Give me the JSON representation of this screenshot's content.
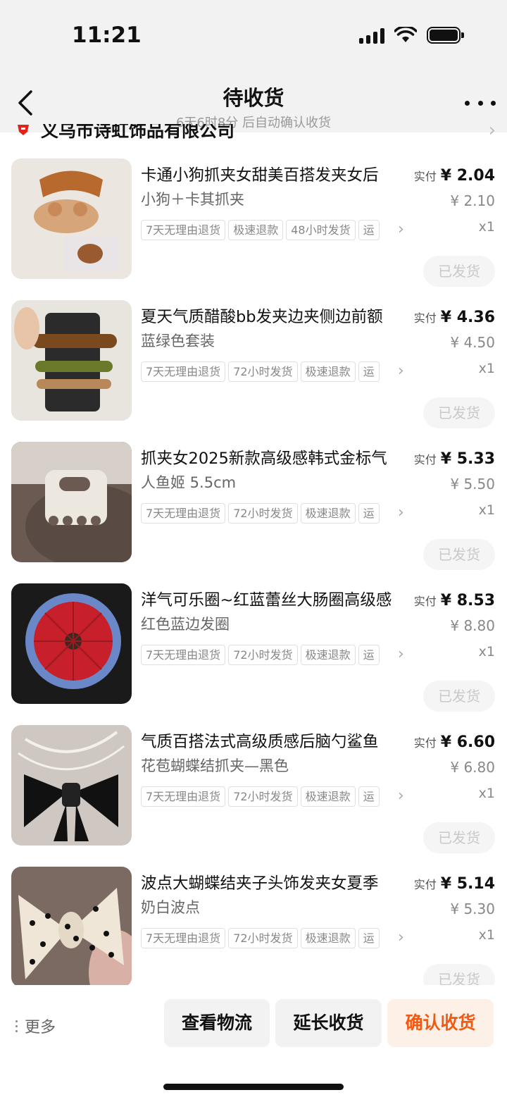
{
  "status": {
    "time": "11:21"
  },
  "nav": {
    "title": "待收货",
    "subtitle": "6天6时8分 后自动确认收货"
  },
  "shop": {
    "name": "义乌市诗虹饰品有限公司",
    "logo_icon": "shop-logo-icon"
  },
  "items": [
    {
      "title": "卡通小狗抓夹女甜美百搭发夹女后",
      "variant": "小狗＋卡其抓夹",
      "tags": [
        "7天无理由退货",
        "极速退款",
        "48小时发货",
        "运"
      ],
      "price_prefix": "实付",
      "price": "¥ 2.04",
      "original_price": "¥ 2.10",
      "qty": "x1",
      "status_button": "已发货"
    },
    {
      "title": "夏天气质醋酸bb发夹边夹侧边前额",
      "variant": "蓝绿色套装",
      "tags": [
        "7天无理由退货",
        "72小时发货",
        "极速退款",
        "运"
      ],
      "price_prefix": "实付",
      "price": "¥ 4.36",
      "original_price": "¥ 4.50",
      "qty": "x1",
      "status_button": "已发货"
    },
    {
      "title": "抓夹女2025新款高级感韩式金标气",
      "variant": "人鱼姬 5.5cm",
      "tags": [
        "7天无理由退货",
        "72小时发货",
        "极速退款",
        "运"
      ],
      "price_prefix": "实付",
      "price": "¥ 5.33",
      "original_price": "¥ 5.50",
      "qty": "x1",
      "status_button": "已发货"
    },
    {
      "title": "洋气可乐圈~红蓝蕾丝大肠圈高级感",
      "variant": "红色蓝边发圈",
      "tags": [
        "7天无理由退货",
        "72小时发货",
        "极速退款",
        "运"
      ],
      "price_prefix": "实付",
      "price": "¥ 8.53",
      "original_price": "¥ 8.80",
      "qty": "x1",
      "status_button": "已发货"
    },
    {
      "title": "气质百搭法式高级质感后脑勺鲨鱼",
      "variant": "花苞蝴蝶结抓夹—黑色",
      "tags": [
        "7天无理由退货",
        "72小时发货",
        "极速退款",
        "运"
      ],
      "price_prefix": "实付",
      "price": "¥ 6.60",
      "original_price": "¥ 6.80",
      "qty": "x1",
      "status_button": "已发货"
    },
    {
      "title": "波点大蝴蝶结夹子头饰发夹女夏季",
      "variant": "奶白波点",
      "tags": [
        "7天无理由退货",
        "72小时发货",
        "极速退款",
        "运"
      ],
      "price_prefix": "实付",
      "price": "¥ 5.14",
      "original_price": "¥ 5.30",
      "qty": "x1",
      "status_button": "已发货"
    }
  ],
  "bottom": {
    "more": "更多",
    "view_logistics": "查看物流",
    "extend_receipt": "延长收货",
    "confirm_receipt": "确认收货"
  }
}
